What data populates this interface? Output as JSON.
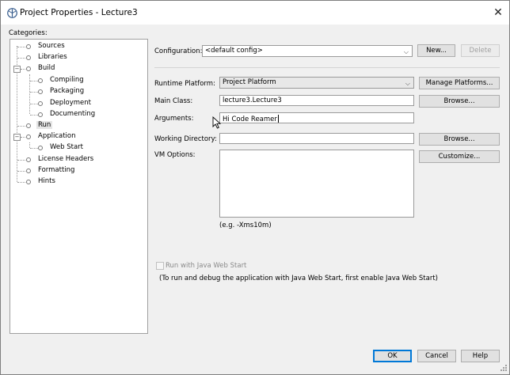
{
  "window": {
    "title": "Project Properties - Lecture3",
    "close_glyph": "✕"
  },
  "categories": {
    "label": "Categories:",
    "items": [
      "Sources",
      "Libraries",
      "Build",
      "Compiling",
      "Packaging",
      "Deployment",
      "Documenting",
      "Run",
      "Application",
      "Web Start",
      "License Headers",
      "Formatting",
      "Hints"
    ],
    "selected": "Run",
    "expander_glyph": "−"
  },
  "config": {
    "label": "Configuration:",
    "value": "<default config>",
    "new_label": "New...",
    "delete_label": "Delete"
  },
  "run": {
    "runtime_label": "Runtime Platform:",
    "runtime_value": "Project Platform",
    "manage_label": "Manage Platforms...",
    "main_class_label": "Main Class:",
    "main_class_value": "lecture3.Lecture3",
    "browse_label": "Browse...",
    "arguments_label": "Arguments:",
    "arguments_value": "Hi Code Reamer",
    "workdir_label": "Working Directory:",
    "workdir_value": "",
    "browse2_label": "Browse...",
    "vm_label": "VM Options:",
    "vm_value": "",
    "customize_label": "Customize...",
    "vm_hint": "(e.g. -Xms10m)",
    "webstart_check_label": "Run with Java Web Start",
    "webstart_note": "(To run and debug the application with Java Web Start, first enable Java Web Start)"
  },
  "footer": {
    "ok_label": "OK",
    "cancel_label": "Cancel",
    "help_label": "Help"
  },
  "glyphs": {
    "dropdown": "⌵"
  }
}
